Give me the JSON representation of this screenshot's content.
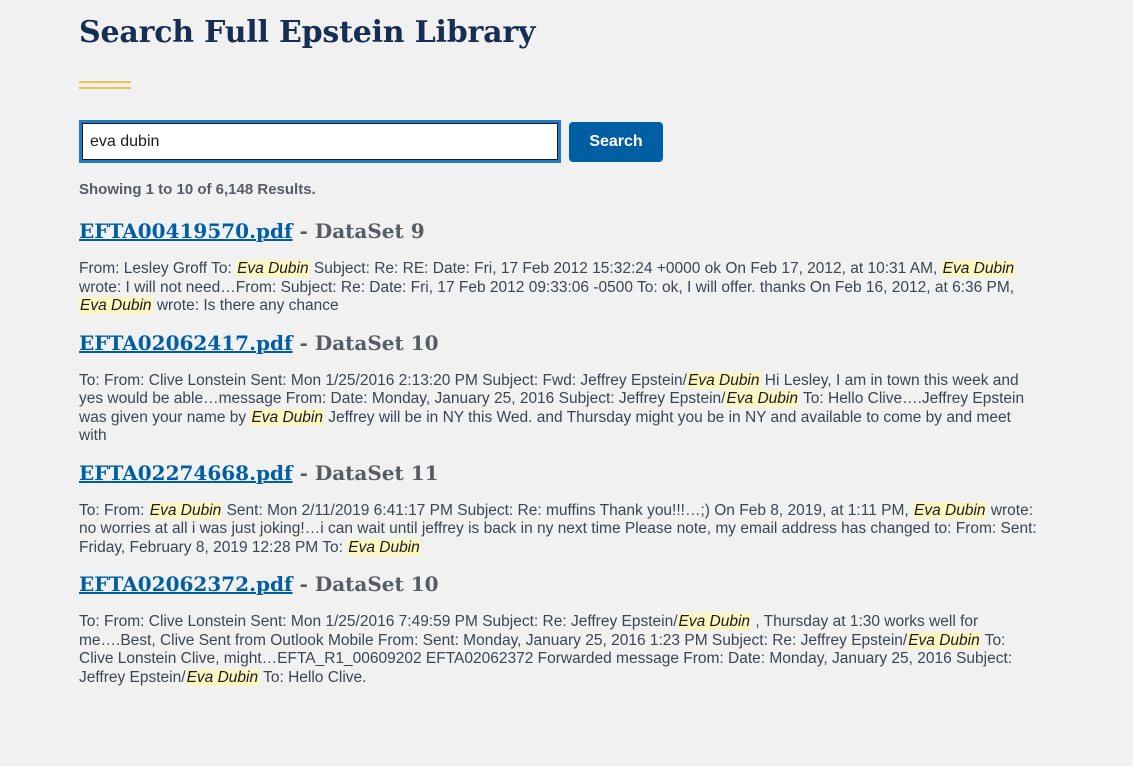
{
  "page": {
    "title": "Search Full Epstein Library",
    "accent_color": "#f4c14e",
    "link_color": "#005ea2",
    "highlight_color": "#fcf6c3"
  },
  "search": {
    "value": "eva dubin",
    "button_label": "Search"
  },
  "results_summary": "Showing 1 to 10 of 6,148 Results.",
  "results": [
    {
      "file": "EFTA00419570.pdf",
      "separator": " - ",
      "dataset": "DataSet 9",
      "snippet": [
        {
          "t": "From: Lesley Groff To: "
        },
        {
          "t": "Eva Dubin",
          "hl": true
        },
        {
          "t": " Subject: Re: RE: Date: Fri, 17 Feb 2012 15:32:24 +0000 ok On Feb 17, 2012, at 10:31 AM, "
        },
        {
          "t": "Eva Dubin",
          "hl": true
        },
        {
          "t": " wrote: I will not need…From: Subject: Re: Date: Fri, 17 Feb 2012 09:33:06 -0500 To: ok, I will offer. thanks On Feb 16, 2012, at 6:36 PM, "
        },
        {
          "t": "Eva Dubin",
          "hl": true
        },
        {
          "t": " wrote: Is there any chance"
        }
      ]
    },
    {
      "file": "EFTA02062417.pdf",
      "separator": " - ",
      "dataset": "DataSet 10",
      "snippet": [
        {
          "t": "To: From: Clive Lonstein Sent: Mon 1/25/2016 2:13:20 PM Subject: Fwd: Jeffrey Epstein/"
        },
        {
          "t": "Eva Dubin",
          "hl": true
        },
        {
          "t": " Hi Lesley, I am in town this week and yes would be able…message From: Date: Monday, January 25, 2016 Subject: Jeffrey Epstein/"
        },
        {
          "t": "Eva Dubin",
          "hl": true
        },
        {
          "t": " To: Hello Clive….Jeffrey Epstein was given your name by "
        },
        {
          "t": "Eva Dubin",
          "hl": true
        },
        {
          "t": " Jeffrey will be in NY this Wed. and Thursday might you be in NY and available to come by and meet with"
        }
      ]
    },
    {
      "file": "EFTA02274668.pdf",
      "separator": " - ",
      "dataset": "DataSet 11",
      "snippet": [
        {
          "t": "To: From: "
        },
        {
          "t": "Eva Dubin",
          "hl": true
        },
        {
          "t": " Sent: Mon 2/11/2019 6:41:17 PM Subject: Re: muffins Thank you!!!…;) On Feb 8, 2019, at 1:11 PM, "
        },
        {
          "t": "Eva Dubin",
          "hl": true
        },
        {
          "t": " wrote: no worries at all i was just joking!…i can wait until jeffrey is back in ny next time Please note, my email address has changed to: From: Sent: Friday, February 8, 2019 12:28 PM To: "
        },
        {
          "t": "Eva Dubin",
          "hl": true
        }
      ]
    },
    {
      "file": "EFTA02062372.pdf",
      "separator": " - ",
      "dataset": "DataSet 10",
      "snippet": [
        {
          "t": "To: From: Clive Lonstein Sent: Mon 1/25/2016 7:49:59 PM Subject: Re: Jeffrey Epstein/"
        },
        {
          "t": "Eva Dubin",
          "hl": true
        },
        {
          "t": " , Thursday at 1:30 works well for me….Best, Clive Sent from Outlook Mobile From: Sent: Monday, January 25, 2016 1:23 PM Subject: Re: Jeffrey Epstein/"
        },
        {
          "t": "Eva Dubin",
          "hl": true
        },
        {
          "t": " To: Clive Lonstein Clive, might…EFTA_R1_00609202 EFTA02062372 Forwarded message From: Date: Monday, January 25, 2016 Subject: Jeffrey Epstein/"
        },
        {
          "t": "Eva Dubin",
          "hl": true
        },
        {
          "t": " To: Hello Clive."
        }
      ]
    }
  ]
}
